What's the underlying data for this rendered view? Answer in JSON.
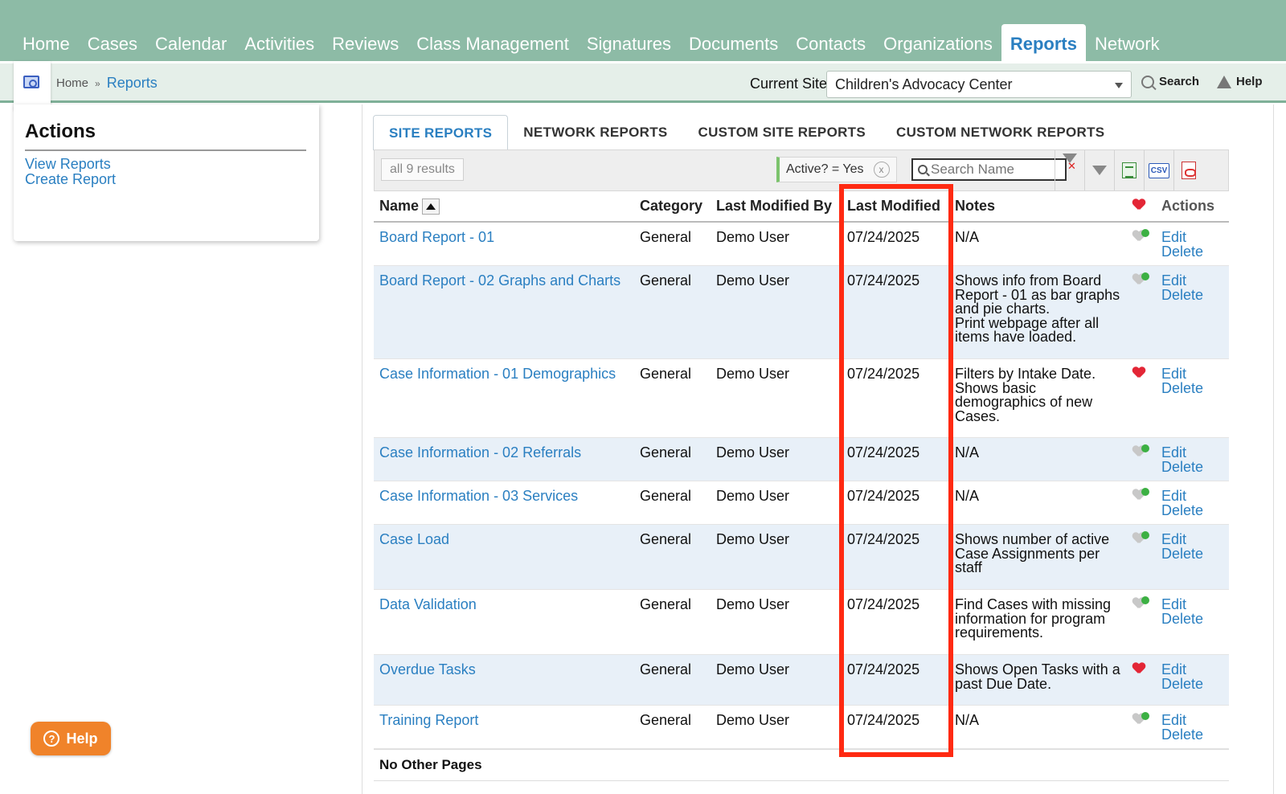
{
  "nav": {
    "items": [
      {
        "label": "Home",
        "id": "home"
      },
      {
        "label": "Cases",
        "id": "cases"
      },
      {
        "label": "Calendar",
        "id": "calendar"
      },
      {
        "label": "Activities",
        "id": "activities"
      },
      {
        "label": "Reviews",
        "id": "reviews"
      },
      {
        "label": "Class Management",
        "id": "class-management"
      },
      {
        "label": "Signatures",
        "id": "signatures"
      },
      {
        "label": "Documents",
        "id": "documents"
      },
      {
        "label": "Contacts",
        "id": "contacts"
      },
      {
        "label": "Organizations",
        "id": "organizations"
      },
      {
        "label": "Reports",
        "id": "reports",
        "active": true
      },
      {
        "label": "Network",
        "id": "network"
      }
    ]
  },
  "breadcrumb": {
    "home": "Home",
    "separator": "»",
    "current": "Reports"
  },
  "site": {
    "label": "Current Site",
    "selected": "Children's Advocacy Center"
  },
  "tools": {
    "search": "Search",
    "help": "Help"
  },
  "actions": {
    "title": "Actions",
    "links": [
      "View Reports",
      "Create Report"
    ]
  },
  "help_bubble": {
    "label": "Help",
    "icon": "?"
  },
  "tabs": [
    {
      "label": "SITE REPORTS",
      "active": true
    },
    {
      "label": "NETWORK REPORTS"
    },
    {
      "label": "CUSTOM SITE REPORTS"
    },
    {
      "label": "CUSTOM NETWORK REPORTS"
    }
  ],
  "toolbar": {
    "results": "all 9 results",
    "filter": "Active? = Yes",
    "filter_clear": "x",
    "search_placeholder": "Search Name",
    "csv": "CSV"
  },
  "table": {
    "headers": {
      "name": "Name",
      "category": "Category",
      "last_modified_by": "Last Modified By",
      "last_modified": "Last Modified",
      "notes": "Notes",
      "actions": "Actions"
    },
    "rows": [
      {
        "name": "Board Report - 01",
        "category": "General",
        "by": "Demo User",
        "date": "07/24/2025",
        "notes": [
          "N/A"
        ],
        "favorite": false
      },
      {
        "name": "Board Report - 02 Graphs and Charts",
        "category": "General",
        "by": "Demo User",
        "date": "07/24/2025",
        "notes": [
          "Shows info from Board",
          "Report - 01 as bar graphs",
          "and pie charts.",
          "Print webpage after all",
          "items have loaded."
        ],
        "favorite": false
      },
      {
        "name": "Case Information - 01 Demographics",
        "category": "General",
        "by": "Demo User",
        "date": "07/24/2025",
        "notes": [
          "Filters by Intake Date.",
          "Shows basic",
          "demographics of new",
          "Cases."
        ],
        "favorite": true
      },
      {
        "name": "Case Information - 02 Referrals",
        "category": "General",
        "by": "Demo User",
        "date": "07/24/2025",
        "notes": [
          "N/A"
        ],
        "favorite": false
      },
      {
        "name": "Case Information - 03 Services",
        "category": "General",
        "by": "Demo User",
        "date": "07/24/2025",
        "notes": [
          "N/A"
        ],
        "favorite": false
      },
      {
        "name": "Case Load",
        "category": "General",
        "by": "Demo User",
        "date": "07/24/2025",
        "notes": [
          "Shows number of active",
          "Case Assignments per",
          "staff"
        ],
        "favorite": false
      },
      {
        "name": "Data Validation",
        "category": "General",
        "by": "Demo User",
        "date": "07/24/2025",
        "notes": [
          "Find Cases with missing",
          "information for program",
          "requirements."
        ],
        "favorite": false
      },
      {
        "name": "Overdue Tasks",
        "category": "General",
        "by": "Demo User",
        "date": "07/24/2025",
        "notes": [
          "Shows Open Tasks with a",
          "past Due Date."
        ],
        "favorite": true
      },
      {
        "name": "Training Report",
        "category": "General",
        "by": "Demo User",
        "date": "07/24/2025",
        "notes": [
          "N/A"
        ],
        "favorite": false
      }
    ],
    "edit_label": "Edit",
    "delete_label": "Delete"
  },
  "footer": {
    "pages": "No Other Pages"
  },
  "colors": {
    "nav_bg": "#8dbba6",
    "link": "#2a7fc1",
    "highlight": "#ff2a12",
    "alt_row": "#e8f0f8",
    "help_orange": "#f0832a"
  }
}
